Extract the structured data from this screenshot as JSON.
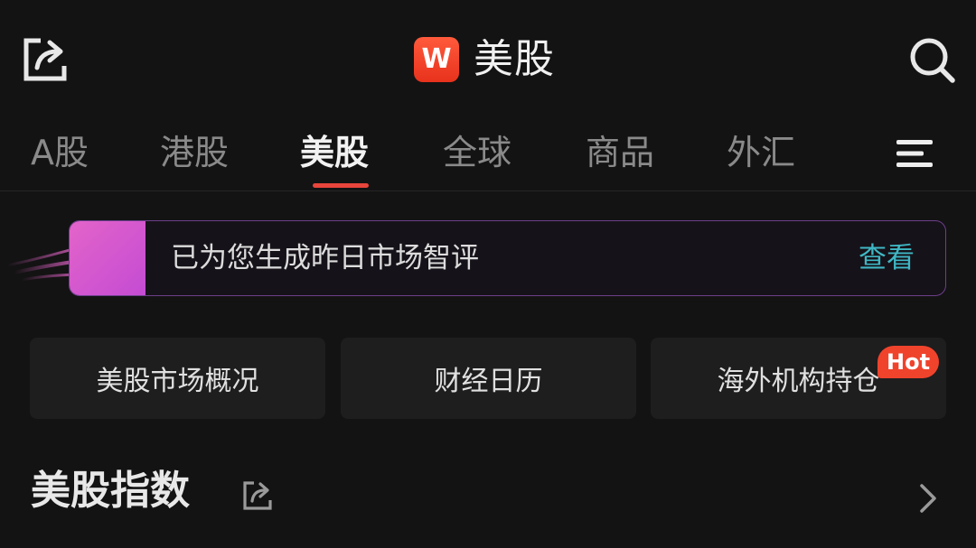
{
  "header": {
    "title": "美股",
    "logo_letter": "W",
    "share_icon": "share-out-icon",
    "search_icon": "search-icon"
  },
  "tabs": [
    {
      "label": "A股",
      "active": false
    },
    {
      "label": "港股",
      "active": false
    },
    {
      "label": "美股",
      "active": true
    },
    {
      "label": "全球",
      "active": false
    },
    {
      "label": "商品",
      "active": false
    },
    {
      "label": "外汇",
      "active": false
    }
  ],
  "ai_banner": {
    "text": "已为您生成昨日市场智评",
    "link": "查看"
  },
  "quick_links": [
    {
      "label": "美股市场概况"
    },
    {
      "label": "财经日历"
    },
    {
      "label": "海外机构持仓",
      "badge": "Hot"
    }
  ],
  "section": {
    "title": "美股指数"
  },
  "colors": {
    "background": "#131313",
    "accent_red": "#e8453c",
    "link_teal": "#3fb7c4",
    "banner_border": "#6c3f8c",
    "hot_badge": "#f0432c"
  }
}
